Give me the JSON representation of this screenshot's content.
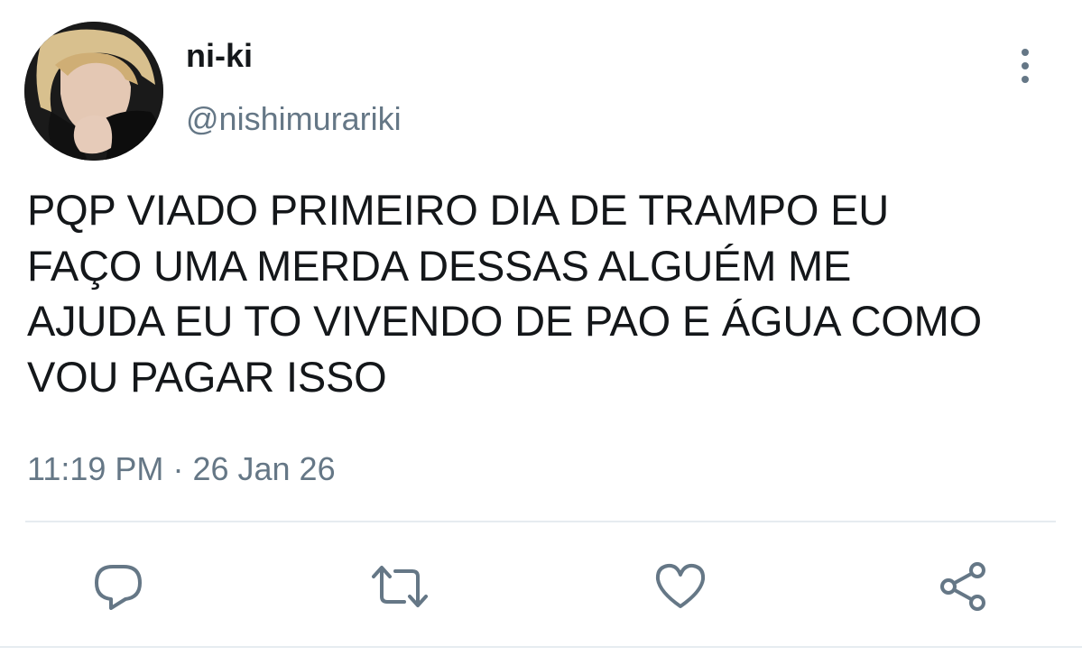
{
  "tweet": {
    "display_name": "ni-ki",
    "handle": "@nishimurariki",
    "text": "PQP VIADO PRIMEIRO DIA DE TRAMPO EU\nFAÇO UMA MERDA DESSAS ALGUÉM ME\nAJUDA EU TO VIVENDO DE PAO E ÁGUA COMO\nVOU PAGAR ISSO",
    "time": "11:19 PM",
    "separator": "·",
    "date": "26 Jan 26"
  },
  "actions": [
    {
      "icon": "reply-icon"
    },
    {
      "icon": "retweet-icon"
    },
    {
      "icon": "like-icon"
    },
    {
      "icon": "share-icon"
    }
  ],
  "colors": {
    "text_primary": "#14171a",
    "text_secondary": "#657786",
    "icon": "#657786",
    "divider": "#e6ecf0"
  }
}
